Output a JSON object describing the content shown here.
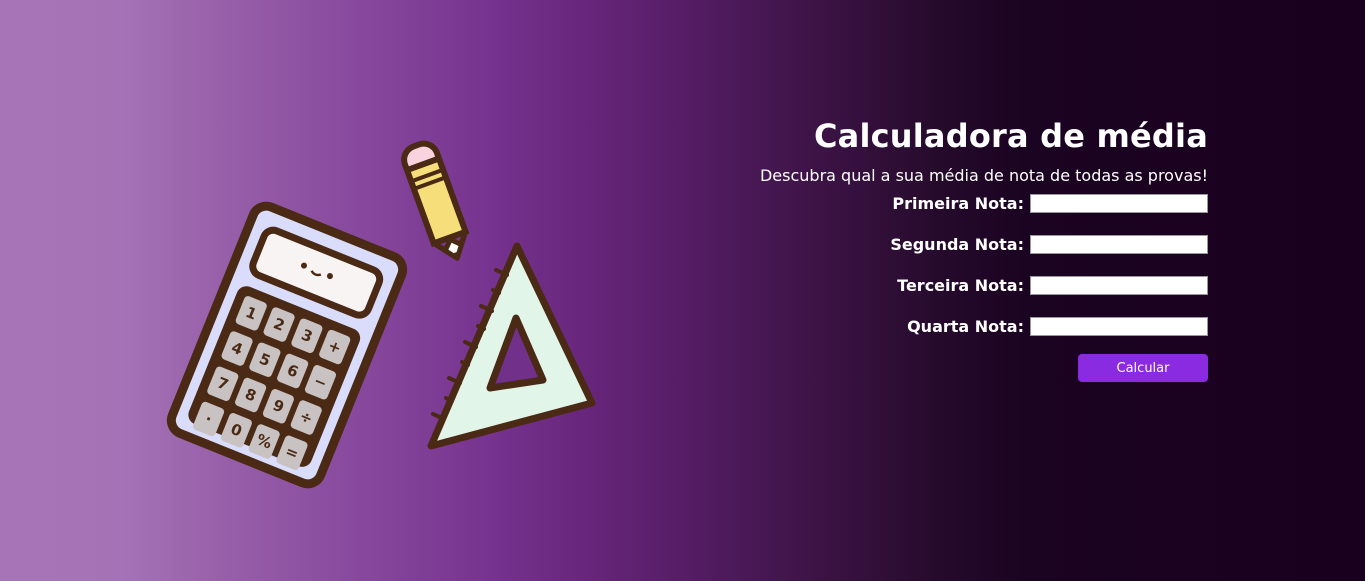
{
  "header": {
    "title": "Calculadora de média",
    "subtitle": "Descubra qual a sua média de nota de todas as provas!"
  },
  "form": {
    "fields": [
      {
        "label": "Primeira Nota:",
        "value": ""
      },
      {
        "label": "Segunda Nota:",
        "value": ""
      },
      {
        "label": "Terceira Nota:",
        "value": ""
      },
      {
        "label": "Quarta Nota:",
        "value": ""
      }
    ],
    "submit_label": "Calcular"
  },
  "illustration": {
    "icons": [
      "calculator-icon",
      "pencil-icon",
      "triangle-ruler-icon"
    ],
    "calculator_keys": [
      "1",
      "2",
      "3",
      "+",
      "4",
      "5",
      "6",
      "−",
      "7",
      "8",
      "9",
      "÷",
      "·",
      "0",
      "%",
      "="
    ]
  },
  "colors": {
    "accent_button": "#8a2be2",
    "text": "#ffffff",
    "outline": "#4a2a14"
  }
}
